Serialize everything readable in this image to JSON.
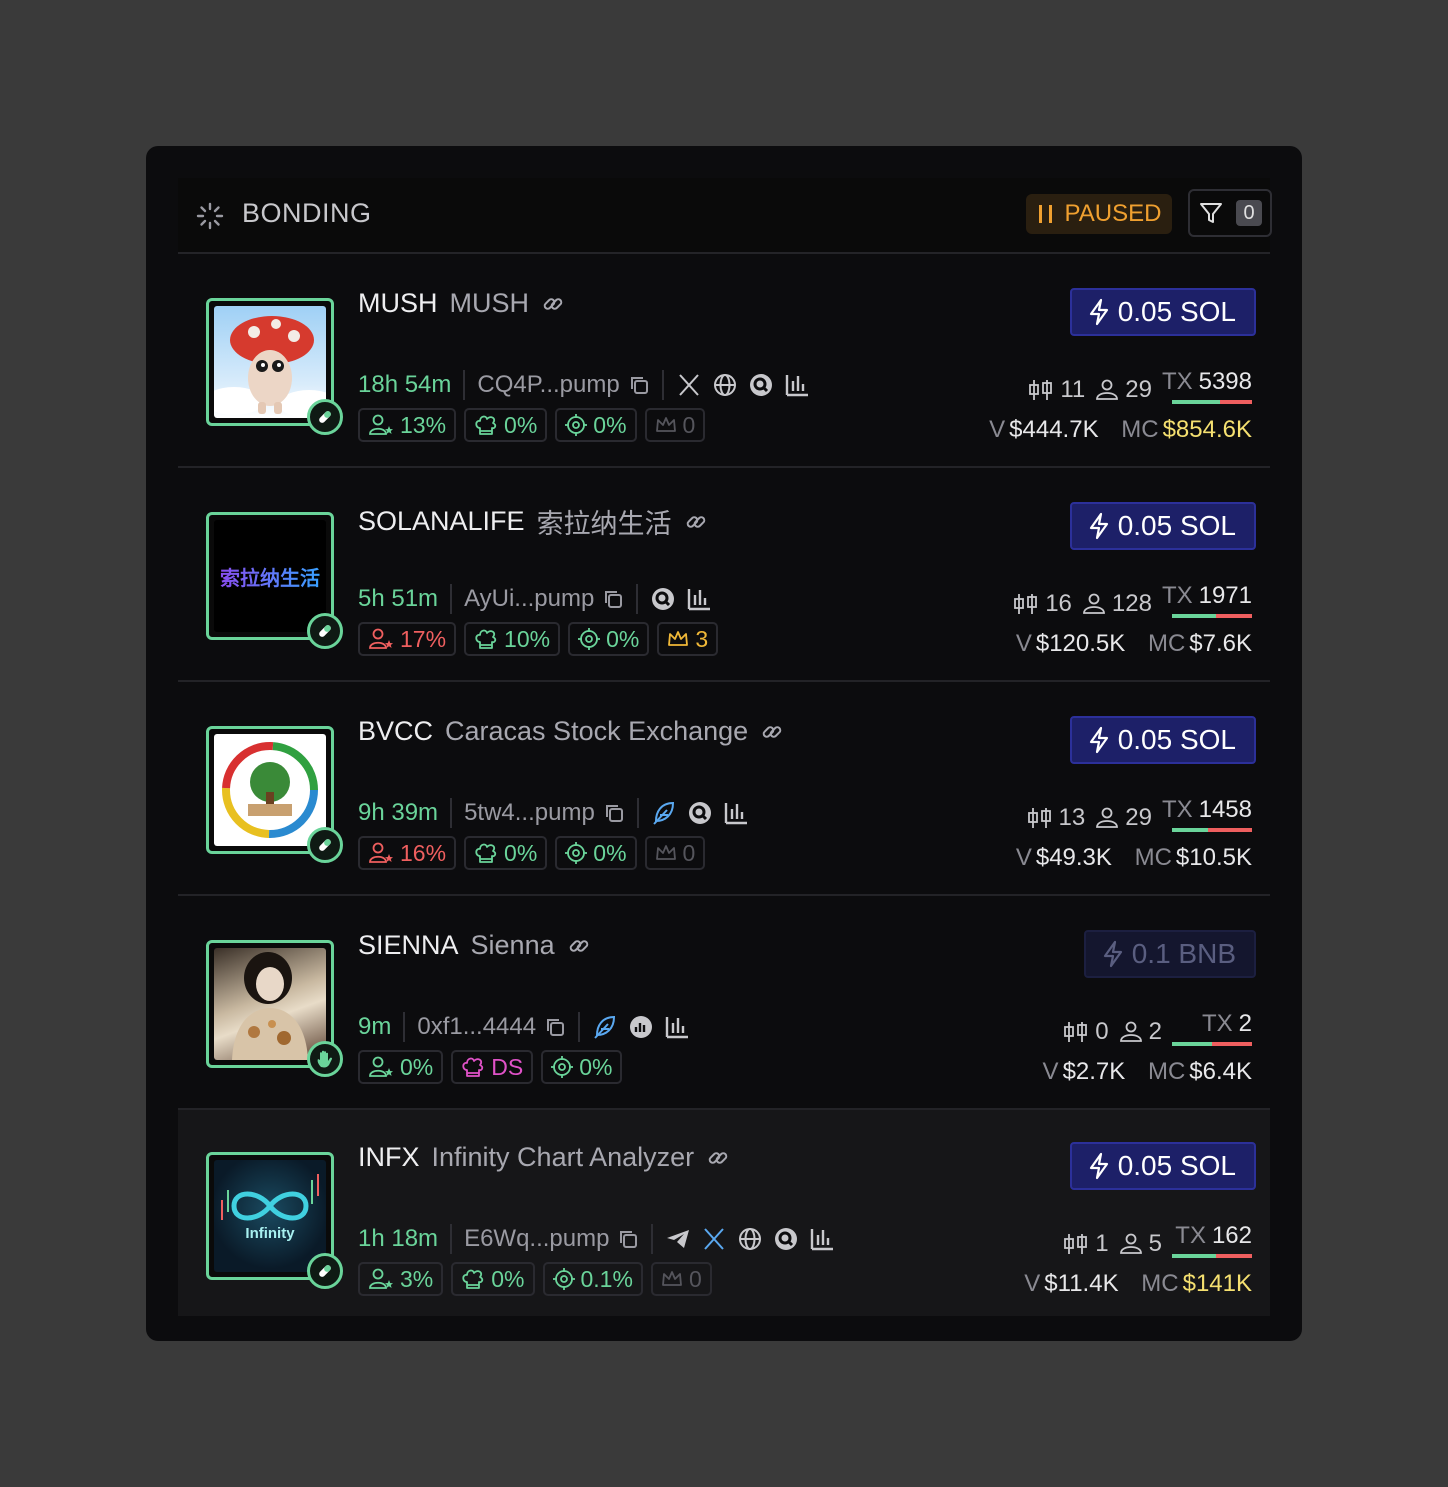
{
  "header": {
    "title": "BONDING",
    "paused_label": "PAUSED",
    "filter_count": "0"
  },
  "colors": {
    "accent_green": "#6ad49a",
    "buy_blue": "#1d2068",
    "paused_orange": "#f0a030",
    "mc_yellow": "#f5e070"
  },
  "tokens": [
    {
      "ticker": "MUSH",
      "name": "MUSH",
      "age": "18h 54m",
      "address": "CQ4P...pump",
      "socials": [
        "x-icon",
        "globe-icon",
        "search-icon",
        "chart-icon"
      ],
      "holders_pct": "13%",
      "dev_pct": "0%",
      "sniper_pct": "0%",
      "crown": "0",
      "buy": "0.05 SOL",
      "trades": "11",
      "holders": "29",
      "tx": "5398",
      "volume": "$444.7K",
      "mc": "$854.6K",
      "buy_ratio": 0.6
    },
    {
      "ticker": "SOLANALIFE",
      "name": "索拉纳生活",
      "age": "5h 51m",
      "address": "AyUi...pump",
      "socials": [
        "search-icon",
        "chart-icon"
      ],
      "holders_pct": "17%",
      "dev_pct": "10%",
      "sniper_pct": "0%",
      "crown": "3",
      "buy": "0.05 SOL",
      "trades": "16",
      "holders": "128",
      "tx": "1971",
      "volume": "$120.5K",
      "mc": "$7.6K",
      "buy_ratio": 0.55,
      "avatar_text": "索拉纳生活"
    },
    {
      "ticker": "BVCC",
      "name": "Caracas Stock Exchange",
      "age": "9h 39m",
      "address": "5tw4...pump",
      "socials": [
        "feather-icon",
        "search-icon",
        "chart-icon"
      ],
      "holders_pct": "16%",
      "dev_pct": "0%",
      "sniper_pct": "0%",
      "crown": "0",
      "buy": "0.05 SOL",
      "trades": "13",
      "holders": "29",
      "tx": "1458",
      "volume": "$49.3K",
      "mc": "$10.5K",
      "buy_ratio": 0.45
    },
    {
      "ticker": "SIENNA",
      "name": "Sienna",
      "age": "9m",
      "address": "0xf1...4444",
      "socials": [
        "feather-icon",
        "pie-icon",
        "chart-icon"
      ],
      "holders_pct": "0%",
      "dev_pct": "DS",
      "sniper_pct": "0%",
      "buy": "0.1 BNB",
      "trades": "0",
      "holders": "2",
      "tx": "2",
      "volume": "$2.7K",
      "mc": "$6.4K",
      "buy_ratio": 0.5
    },
    {
      "ticker": "INFX",
      "name": "Infinity Chart Analyzer",
      "age": "1h 18m",
      "address": "E6Wq...pump",
      "socials": [
        "telegram-icon",
        "x-icon",
        "globe-icon",
        "search-icon",
        "chart-icon"
      ],
      "holders_pct": "3%",
      "dev_pct": "0%",
      "sniper_pct": "0.1%",
      "crown": "0",
      "buy": "0.05 SOL",
      "trades": "1",
      "holders": "5",
      "tx": "162",
      "volume": "$11.4K",
      "mc": "$141K",
      "buy_ratio": 0.55,
      "avatar_text": "Infinity"
    }
  ]
}
